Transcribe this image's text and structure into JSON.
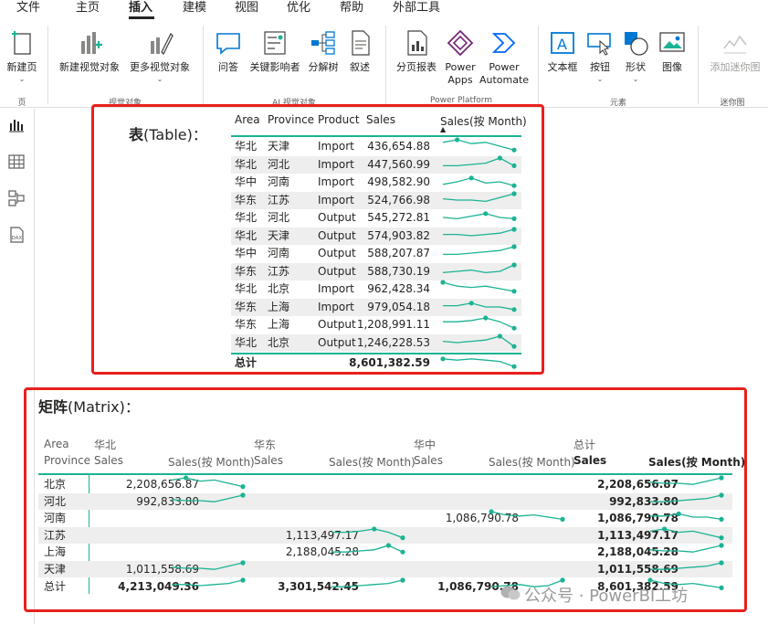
{
  "menu": [
    "文件",
    "主页",
    "插入",
    "建模",
    "视图",
    "优化",
    "帮助",
    "外部工具"
  ],
  "menu_active": 2,
  "ribbon": {
    "buttons": [
      {
        "icon": "new-page-icon",
        "label": "新建页",
        "caret": true
      },
      {
        "icon": "new-visual-icon",
        "label": "新建视觉对象"
      },
      {
        "icon": "more-visuals-icon",
        "label": "更多视觉对象",
        "caret": true
      },
      {
        "icon": "qa-icon",
        "label": "问答"
      },
      {
        "icon": "key-influencers-icon",
        "label": "关键影响者"
      },
      {
        "icon": "decomposition-tree-icon",
        "label": "分解树"
      },
      {
        "icon": "narrative-icon",
        "label": "叙述"
      },
      {
        "icon": "paginated-report-icon",
        "label": "分页报表"
      },
      {
        "icon": "power-apps-icon",
        "label": "Power",
        "label2": "Apps"
      },
      {
        "icon": "power-automate-icon",
        "label": "Power",
        "label2": "Automate"
      },
      {
        "icon": "textbox-icon",
        "label": "文本框"
      },
      {
        "icon": "button-icon",
        "label": "按钮",
        "caret": true
      },
      {
        "icon": "shapes-icon",
        "label": "形状",
        "caret": true
      },
      {
        "icon": "image-icon",
        "label": "图像"
      },
      {
        "icon": "sparkline-icon",
        "label": "添加迷你图",
        "disabled": true
      }
    ],
    "groups": [
      "页",
      "视觉对象",
      "AI 视觉对象",
      "Power Platform",
      "元素",
      "迷你图"
    ]
  },
  "accent_color": "#1ab394",
  "highlight_color": "#e8201c",
  "table": {
    "title_bold": "表",
    "title_rest": "(Table)：",
    "columns": [
      "Area",
      "Province",
      "Product",
      "Sales",
      "Sales(按 Month)"
    ],
    "rows": [
      [
        "华北",
        "天津",
        "Import",
        "436,654.88"
      ],
      [
        "华北",
        "河北",
        "Import",
        "447,560.99"
      ],
      [
        "华中",
        "河南",
        "Import",
        "498,582.90"
      ],
      [
        "华东",
        "江苏",
        "Import",
        "524,766.98"
      ],
      [
        "华北",
        "河北",
        "Output",
        "545,272.81"
      ],
      [
        "华北",
        "天津",
        "Output",
        "574,903.82"
      ],
      [
        "华中",
        "河南",
        "Output",
        "588,207.87"
      ],
      [
        "华东",
        "江苏",
        "Output",
        "588,730.19"
      ],
      [
        "华北",
        "北京",
        "Import",
        "962,428.34"
      ],
      [
        "华东",
        "上海",
        "Import",
        "979,054.18"
      ],
      [
        "华东",
        "上海",
        "Output",
        "1,208,991.11"
      ],
      [
        "华北",
        "北京",
        "Output",
        "1,246,228.53"
      ]
    ],
    "total_label": "总计",
    "total_value": "8,601,382.59"
  },
  "matrix": {
    "title_bold": "矩阵",
    "title_rest": "(Matrix)：",
    "row_headers": [
      "Area",
      "Province"
    ],
    "groups": [
      "华北",
      "华东",
      "华中",
      "总计"
    ],
    "sub_columns": [
      "Sales",
      "Sales(按 Month)"
    ],
    "rows": [
      {
        "label": "北京",
        "values": [
          "2,208,656.87",
          "",
          "",
          "2,208,656.87"
        ]
      },
      {
        "label": "河北",
        "values": [
          "992,833.80",
          "",
          "",
          "992,833.80"
        ]
      },
      {
        "label": "河南",
        "values": [
          "",
          "",
          "1,086,790.78",
          "1,086,790.78"
        ]
      },
      {
        "label": "江苏",
        "values": [
          "",
          "1,113,497.17",
          "",
          "1,113,497.17"
        ]
      },
      {
        "label": "上海",
        "values": [
          "",
          "2,188,045.28",
          "",
          "2,188,045.28"
        ]
      },
      {
        "label": "天津",
        "values": [
          "1,011,558.69",
          "",
          "",
          "1,011,558.69"
        ]
      }
    ],
    "total_label": "总计",
    "total_values": [
      "4,213,049.36",
      "3,301,542.45",
      "1,086,790.78",
      "8,601,382.59"
    ]
  },
  "watermark": "公众号 · PowerBI工坊"
}
